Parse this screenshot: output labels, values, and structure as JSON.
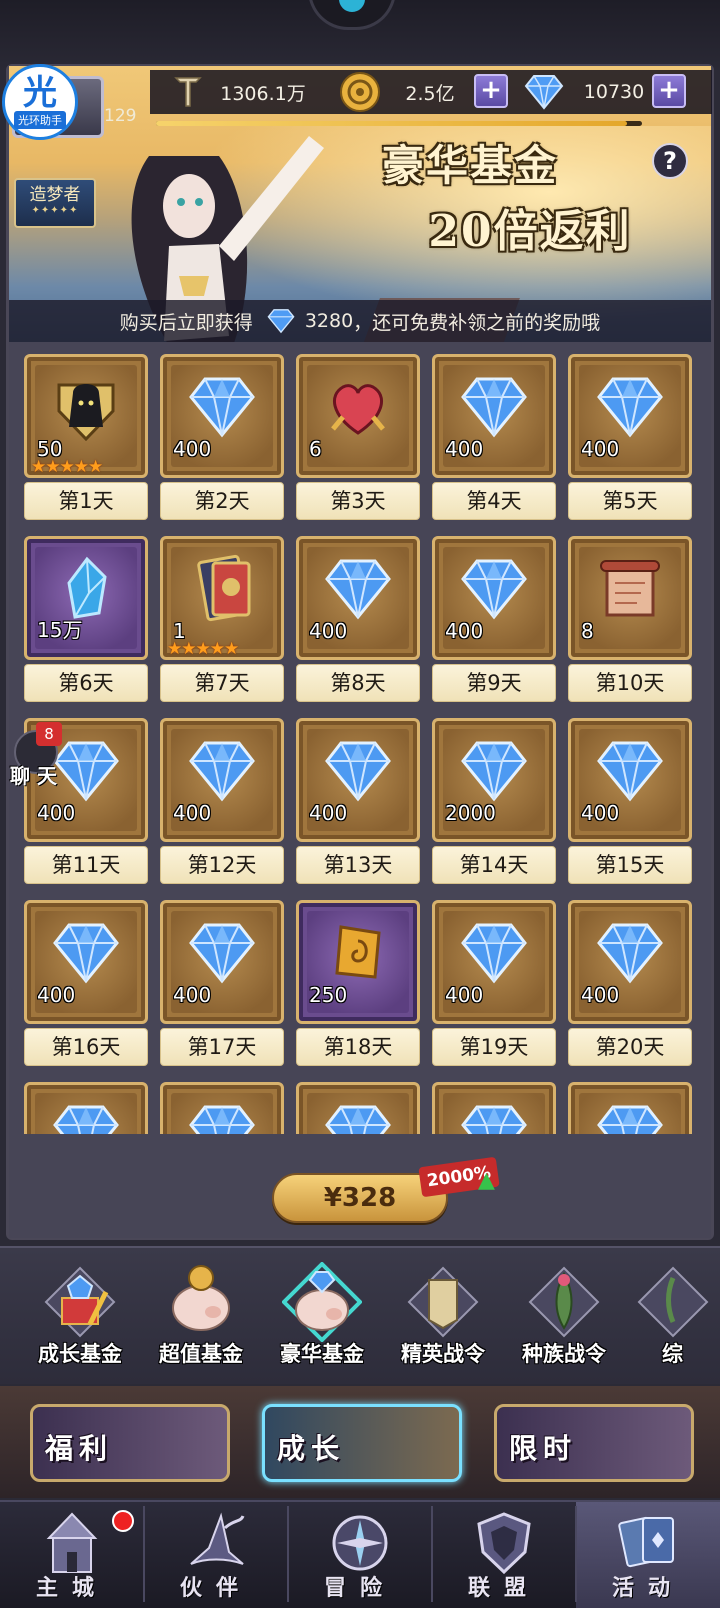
{
  "header": {
    "helper_big": "光",
    "helper_label": "光环助手",
    "level": "129",
    "rank_title": "造梦者",
    "rank_dots": "✦✦✦✦✦",
    "power": "1306.1万",
    "gold": "2.5亿",
    "gems": "10730",
    "help": "?",
    "xp_progress": 0.97
  },
  "promo": {
    "line1": "豪华基金",
    "line2": "20倍返利",
    "info_prefix": "购买后立即获得",
    "info_amount": "3280",
    "info_suffix": "，还可免费补领之前的奖励哦"
  },
  "rewards": [
    {
      "day": "第1天",
      "qty": "50",
      "icon": "hooded-hero-icon",
      "bg": "brown",
      "stars": 5
    },
    {
      "day": "第2天",
      "qty": "400",
      "icon": "diamond-icon",
      "bg": "brown"
    },
    {
      "day": "第3天",
      "qty": "6",
      "icon": "heart-orb-icon",
      "bg": "brown"
    },
    {
      "day": "第4天",
      "qty": "400",
      "icon": "diamond-icon",
      "bg": "brown"
    },
    {
      "day": "第5天",
      "qty": "400",
      "icon": "diamond-icon",
      "bg": "brown"
    },
    {
      "day": "第6天",
      "qty": "15万",
      "icon": "blue-crystal-icon",
      "bg": "purple"
    },
    {
      "day": "第7天",
      "qty": "1",
      "icon": "hero-card-icon",
      "bg": "brown",
      "stars": 5
    },
    {
      "day": "第8天",
      "qty": "400",
      "icon": "diamond-icon",
      "bg": "brown"
    },
    {
      "day": "第9天",
      "qty": "400",
      "icon": "diamond-icon",
      "bg": "brown"
    },
    {
      "day": "第10天",
      "qty": "8",
      "icon": "scroll-icon",
      "bg": "brown"
    },
    {
      "day": "第11天",
      "qty": "400",
      "icon": "diamond-icon",
      "bg": "brown"
    },
    {
      "day": "第12天",
      "qty": "400",
      "icon": "diamond-icon",
      "bg": "brown"
    },
    {
      "day": "第13天",
      "qty": "400",
      "icon": "diamond-icon",
      "bg": "brown"
    },
    {
      "day": "第14天",
      "qty": "2000",
      "icon": "diamond-icon",
      "bg": "brown"
    },
    {
      "day": "第15天",
      "qty": "400",
      "icon": "diamond-icon",
      "bg": "brown"
    },
    {
      "day": "第16天",
      "qty": "400",
      "icon": "diamond-icon",
      "bg": "brown"
    },
    {
      "day": "第17天",
      "qty": "400",
      "icon": "diamond-icon",
      "bg": "brown"
    },
    {
      "day": "第18天",
      "qty": "250",
      "icon": "gold-rune-icon",
      "bg": "purple"
    },
    {
      "day": "第19天",
      "qty": "400",
      "icon": "diamond-icon",
      "bg": "brown"
    },
    {
      "day": "第20天",
      "qty": "400",
      "icon": "diamond-icon",
      "bg": "brown"
    },
    {
      "day": "",
      "qty": "",
      "icon": "diamond-icon",
      "bg": "brown"
    },
    {
      "day": "",
      "qty": "",
      "icon": "diamond-icon",
      "bg": "brown"
    },
    {
      "day": "",
      "qty": "",
      "icon": "diamond-icon",
      "bg": "brown"
    },
    {
      "day": "",
      "qty": "",
      "icon": "diamond-icon",
      "bg": "brown"
    },
    {
      "day": "",
      "qty": "",
      "icon": "diamond-icon",
      "bg": "brown"
    }
  ],
  "purchase": {
    "price": "¥328",
    "bonus": "2000%"
  },
  "chat": {
    "badge": "8",
    "label": "聊 天"
  },
  "fund_tabs": [
    {
      "label": "成长基金",
      "icon": "growth-fund-icon"
    },
    {
      "label": "超值基金",
      "icon": "value-fund-pig-icon"
    },
    {
      "label": "豪华基金",
      "icon": "deluxe-fund-pig-icon",
      "active": true
    },
    {
      "label": "精英战令",
      "icon": "elite-pass-icon"
    },
    {
      "label": "种族战令",
      "icon": "race-pass-icon"
    },
    {
      "label": "综",
      "icon": "more-tab-icon"
    }
  ],
  "categories": [
    {
      "label": "福利"
    },
    {
      "label": "成长",
      "active": true
    },
    {
      "label": "限时"
    }
  ],
  "nav": [
    {
      "label": "主城",
      "icon": "castle-icon"
    },
    {
      "label": "伙伴",
      "icon": "wizard-hat-icon"
    },
    {
      "label": "冒险",
      "icon": "compass-icon"
    },
    {
      "label": "联盟",
      "icon": "shield-icon"
    },
    {
      "label": "活动",
      "icon": "cards-icon",
      "active": true
    }
  ],
  "colors": {
    "gem_blue": "#3f8ff0",
    "gold": "#e6b44a",
    "tile_brown": "#a0763d",
    "tile_purple": "#6a4c8e",
    "accent_active": "#7ae0ff"
  }
}
